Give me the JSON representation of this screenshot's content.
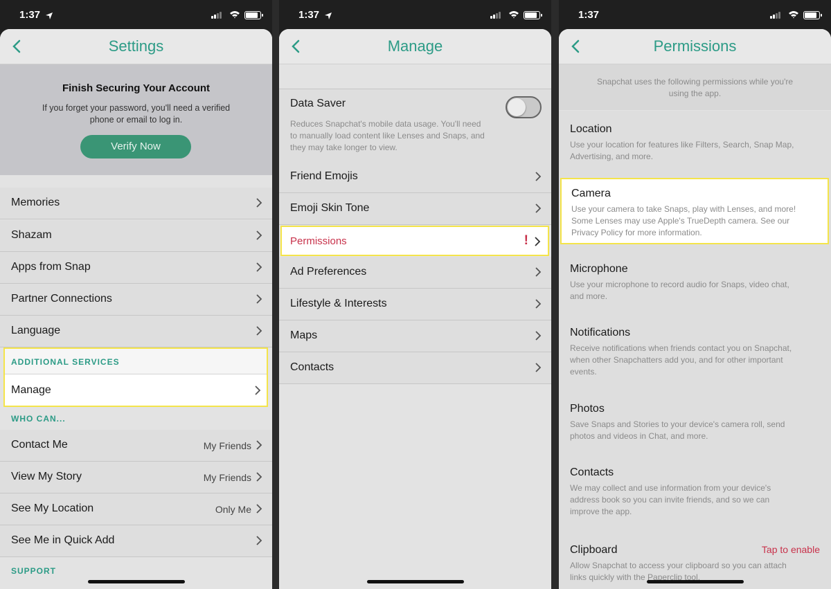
{
  "status": {
    "time_1": "1:37",
    "time_2": "1:37",
    "time_3": "1:37"
  },
  "settings": {
    "title": "Settings",
    "banner_title": "Finish Securing Your Account",
    "banner_text_1": "If you forget your password, you'll need a verified",
    "banner_text_2": "phone or email to log in.",
    "verify_button": "Verify Now",
    "items": [
      "Memories",
      "Shazam",
      "Apps from Snap",
      "Partner Connections",
      "Language"
    ],
    "section_additional": "ADDITIONAL SERVICES",
    "manage": "Manage",
    "section_who": "WHO CAN...",
    "who_items": [
      {
        "label": "Contact Me",
        "value": "My Friends"
      },
      {
        "label": "View My Story",
        "value": "My Friends"
      },
      {
        "label": "See My Location",
        "value": "Only Me"
      },
      {
        "label": "See Me in Quick Add",
        "value": ""
      }
    ],
    "section_support": "SUPPORT"
  },
  "manage": {
    "title": "Manage",
    "data_saver_label": "Data Saver",
    "data_saver_desc_1": "Reduces Snapchat's mobile data usage. You'll need",
    "data_saver_desc_2": "to manually load content like Lenses and Snaps, and",
    "data_saver_desc_3": "they may take longer to view.",
    "data_saver_on": false,
    "items": [
      "Friend Emojis",
      "Emoji Skin Tone",
      "Permissions",
      "Ad Preferences",
      "Lifestyle & Interests",
      "Maps",
      "Contacts"
    ],
    "alert_mark": "!"
  },
  "permissions": {
    "title": "Permissions",
    "intro_1": "Snapchat uses the following permissions while you're",
    "intro_2": "using the app.",
    "items": [
      {
        "title": "Location",
        "d1": "Use your location for features like Filters, Search, Snap Map,",
        "d2": "Advertising, and more.",
        "d3": ""
      },
      {
        "title": "Camera",
        "d1": "Use your camera to take Snaps, play with Lenses, and more!",
        "d2": "Some Lenses may use Apple's TrueDepth camera. See our",
        "d3": "Privacy Policy for more information."
      },
      {
        "title": "Microphone",
        "d1": "Use your microphone to record audio for Snaps, video chat,",
        "d2": "and more.",
        "d3": ""
      },
      {
        "title": "Notifications",
        "d1": "Receive notifications when friends contact you on Snapchat,",
        "d2": "when other Snapchatters add you, and for other important",
        "d3": "events."
      },
      {
        "title": "Photos",
        "d1": "Save Snaps and Stories to your device's camera roll, send",
        "d2": "photos and videos in Chat, and more.",
        "d3": ""
      },
      {
        "title": "Contacts",
        "d1": "We may collect and use information from your device's",
        "d2": "address book so you can invite friends, and so we can",
        "d3": "improve the app."
      },
      {
        "title": "Clipboard",
        "d1": "Allow Snapchat to access your clipboard so you can attach",
        "d2": "links quickly with the Paperclip tool.",
        "d3": ""
      }
    ],
    "tap_to_enable": "Tap to enable"
  },
  "colors": {
    "accent": "#2c9b86",
    "highlight": "#f4e44a",
    "alert": "#c8324b"
  }
}
